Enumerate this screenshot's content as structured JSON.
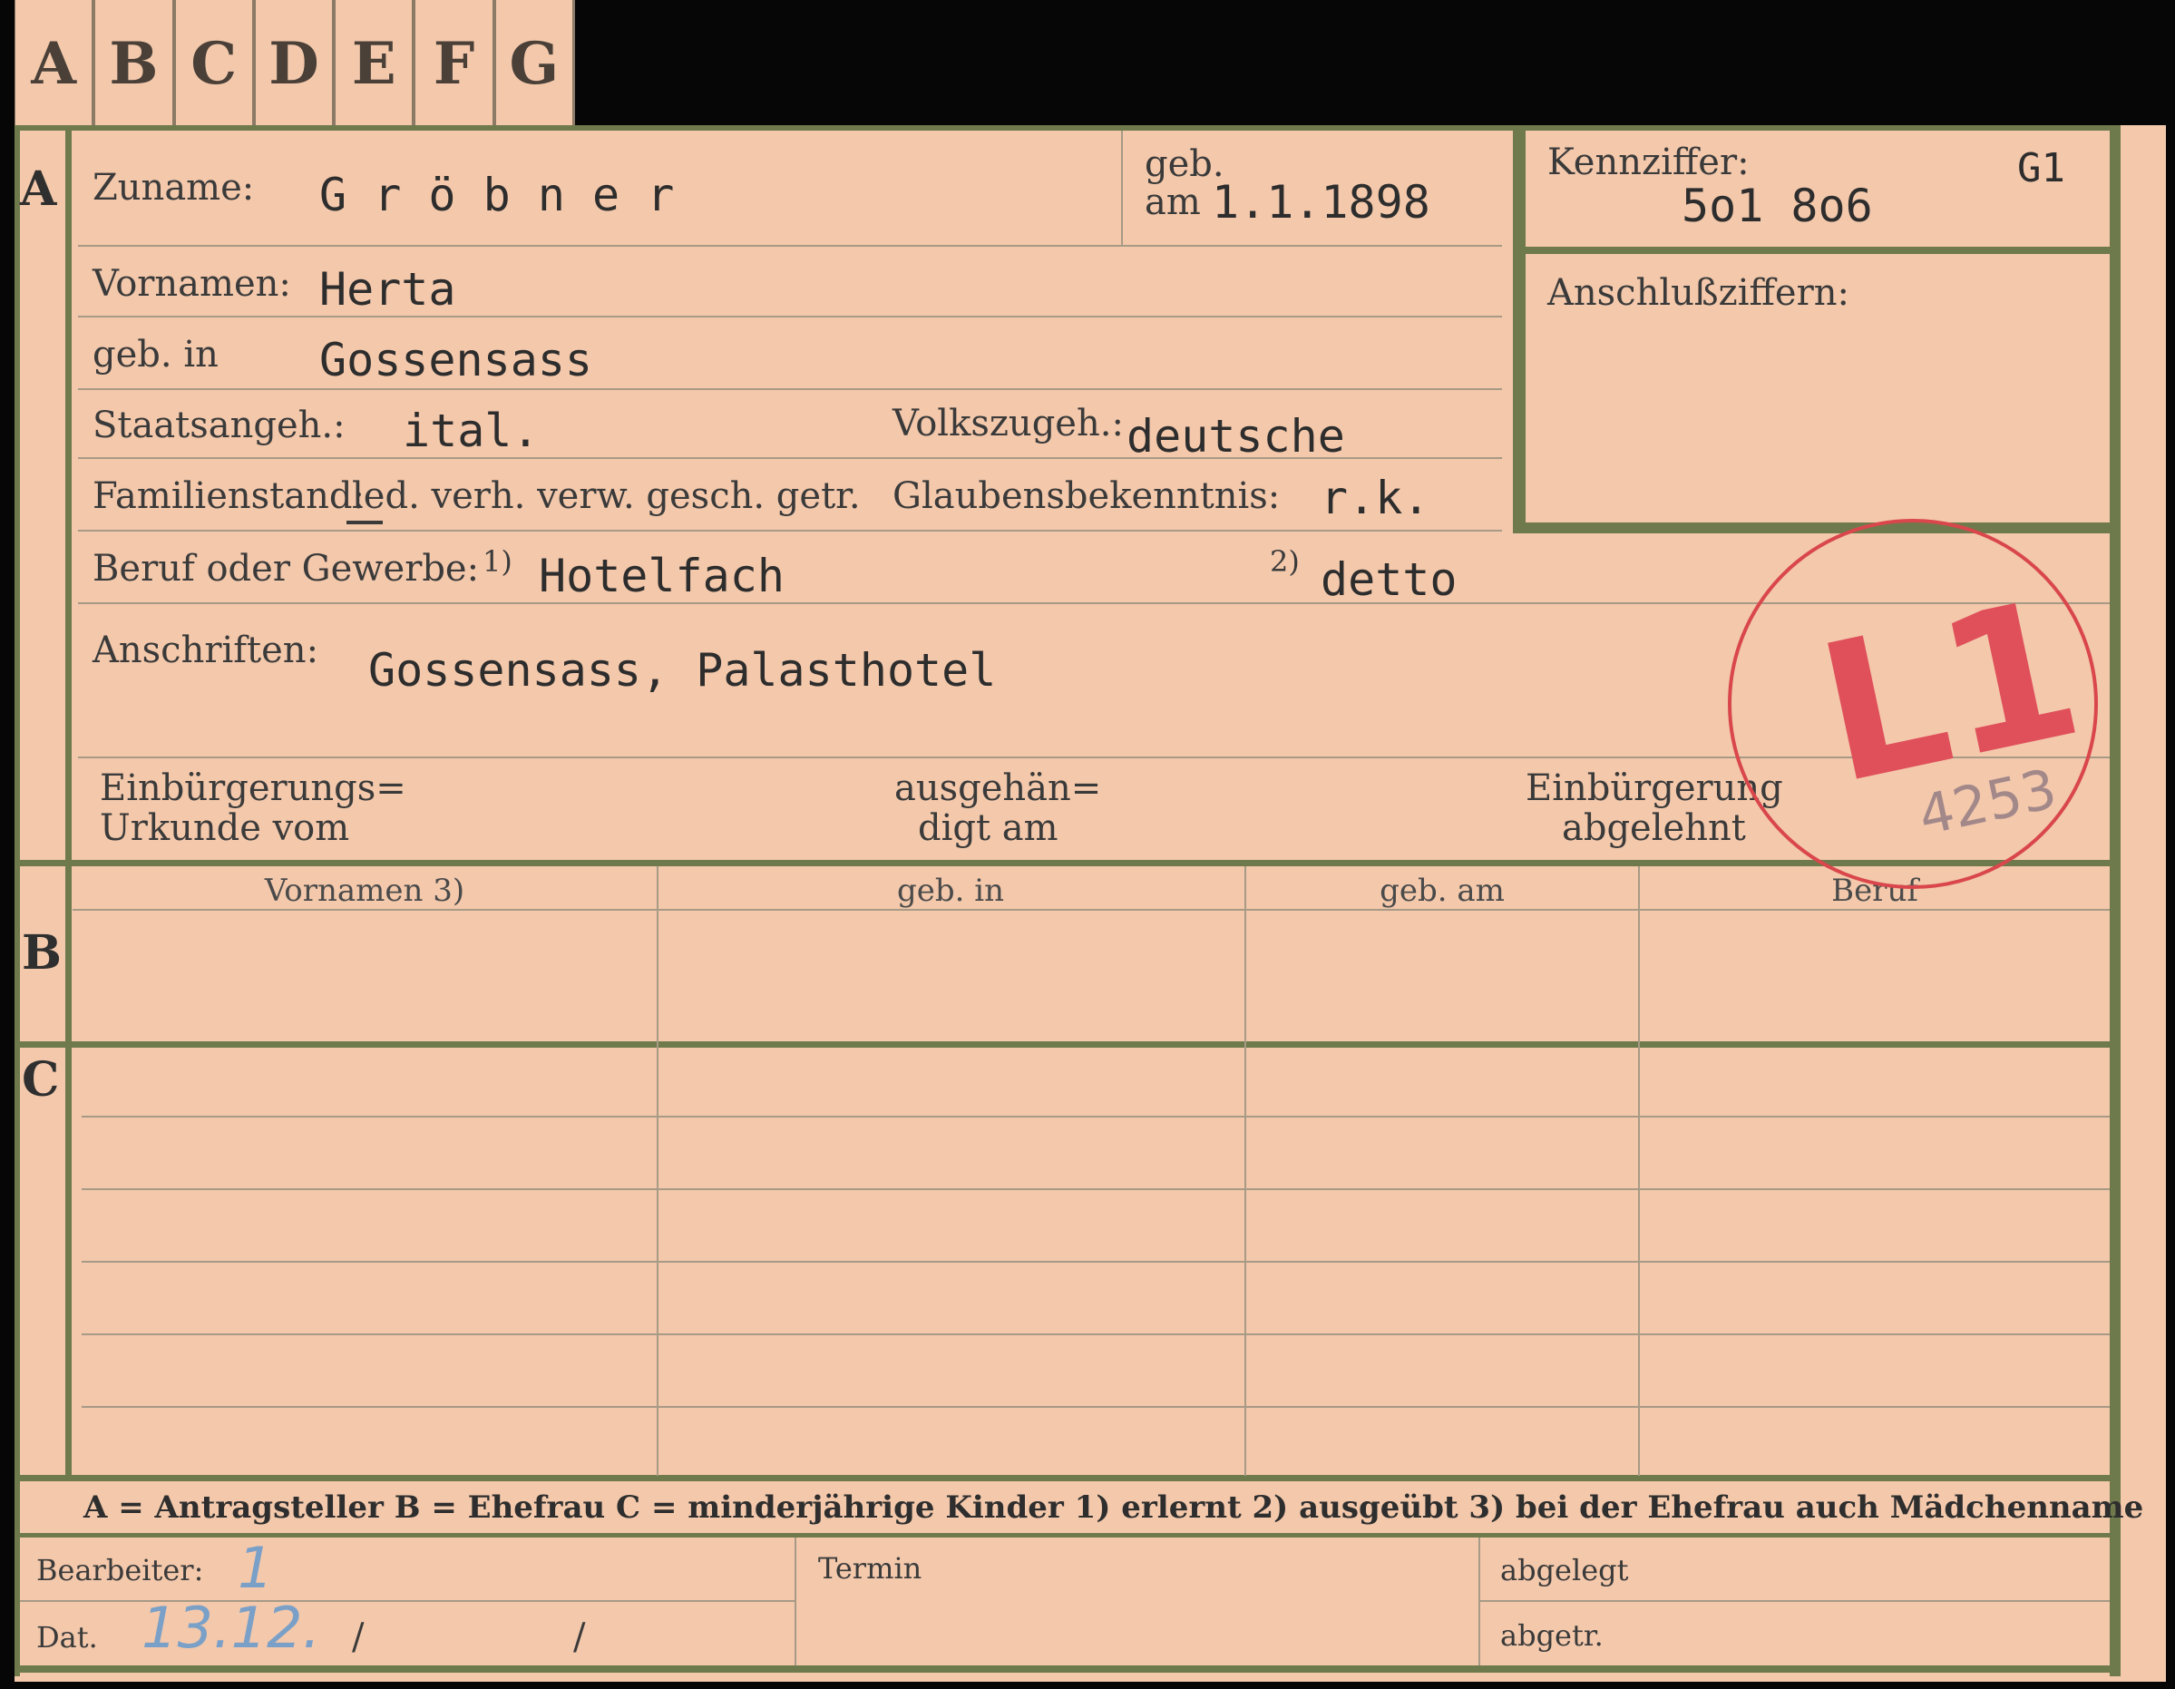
{
  "tabs": [
    "A",
    "B",
    "C",
    "D",
    "E",
    "F",
    "G"
  ],
  "section_labels": {
    "a": "A",
    "b": "B",
    "c": "C"
  },
  "surname": {
    "label": "Zuname:",
    "value": "G r ö b n e r"
  },
  "birth": {
    "label_top": "geb.",
    "label_bottom": "am",
    "value": "1.1.1898"
  },
  "kennziffer": {
    "label": "Kennziffer:",
    "value": "5o1 8o6",
    "code": "G1"
  },
  "anschluss": {
    "label": "Anschlußziffern:"
  },
  "vornamen": {
    "label": "Vornamen:",
    "value": "Herta"
  },
  "geb_in": {
    "label": "geb. in",
    "value": "Gossensass"
  },
  "staatsangeh": {
    "label": "Staatsangeh.:",
    "value": "ital."
  },
  "volkszugeh": {
    "label": "Volkszugeh.:",
    "value": "deutsche"
  },
  "familienstand": {
    "label": "Familienstand:",
    "options": "led. verh. verw. gesch. getr."
  },
  "glauben": {
    "label": "Glaubensbekenntnis:",
    "value": "r.k."
  },
  "beruf": {
    "label": "Beruf oder Gewerbe:",
    "m1": "1)",
    "value1": "Hotelfach",
    "m2": "2)",
    "value2": "detto"
  },
  "anschriften": {
    "label": "Anschriften:",
    "value": "Gossensass, Palasthotel"
  },
  "einb": {
    "urkunde_l1": "Einbürgerungs=",
    "urkunde_l2": "Urkunde vom",
    "ausg_l1": "ausgehän=",
    "ausg_l2": "digt am",
    "abg_l1": "Einbürgerung",
    "abg_l2": "abgelehnt"
  },
  "table_headers": [
    "Vornamen 3)",
    "geb. in",
    "geb. am",
    "Beruf"
  ],
  "legend": "A = Antragsteller   B = Ehefrau   C = minderjährige Kinder   1) erlernt   2) ausgeübt   3) bei der Ehefrau auch Mädchenname",
  "footer": {
    "bearbeiter": "Bearbeiter:",
    "bearbeiter_value": "1",
    "dat": "Dat.",
    "dat_value": "13.12.",
    "slash1": "/",
    "slash2": "/",
    "termin": "Termin",
    "abgelegt": "abgelegt",
    "abgetr": "abgetr."
  },
  "stamp": {
    "code": "L1",
    "number": "4253"
  },
  "colors": {
    "card": "#f3c8ab",
    "border": "#6f7a4c",
    "stamp": "#e0505a",
    "ink_blue": "#7aa0c8"
  }
}
